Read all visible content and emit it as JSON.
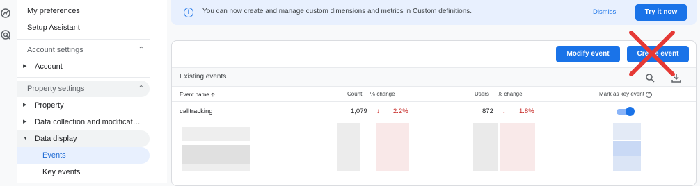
{
  "rail": {
    "icons": [
      "analytics-icon",
      "ads-target-icon"
    ]
  },
  "nav": {
    "items": [
      {
        "label": "My preferences"
      },
      {
        "label": "Setup Assistant"
      }
    ],
    "account_settings": {
      "label": "Account settings",
      "children": [
        "Account"
      ]
    },
    "property_settings": {
      "label": "Property settings",
      "children": [
        "Property",
        "Data collection and modificat…",
        "Data display"
      ],
      "data_display_children": [
        "Events",
        "Key events"
      ]
    }
  },
  "banner": {
    "message": "You can now create and manage custom dimensions and metrics in Custom definitions.",
    "dismiss_label": "Dismiss",
    "try_label": "Try it now"
  },
  "toolbar": {
    "modify_label": "Modify event",
    "create_label": "Create event"
  },
  "table": {
    "title": "Existing events",
    "columns": {
      "event_name": "Event name",
      "count": "Count",
      "count_change": "% change",
      "users": "Users",
      "users_change": "% change",
      "key_event": "Mark as key event"
    },
    "rows": [
      {
        "event_name": "calltracking",
        "count": "1,079",
        "count_change": "2.2%",
        "users": "872",
        "users_change": "1.8%",
        "key_event": true
      }
    ]
  },
  "colors": {
    "primary": "#1a73e8",
    "negative": "#c5221f",
    "overlay_x": "#e53935"
  }
}
